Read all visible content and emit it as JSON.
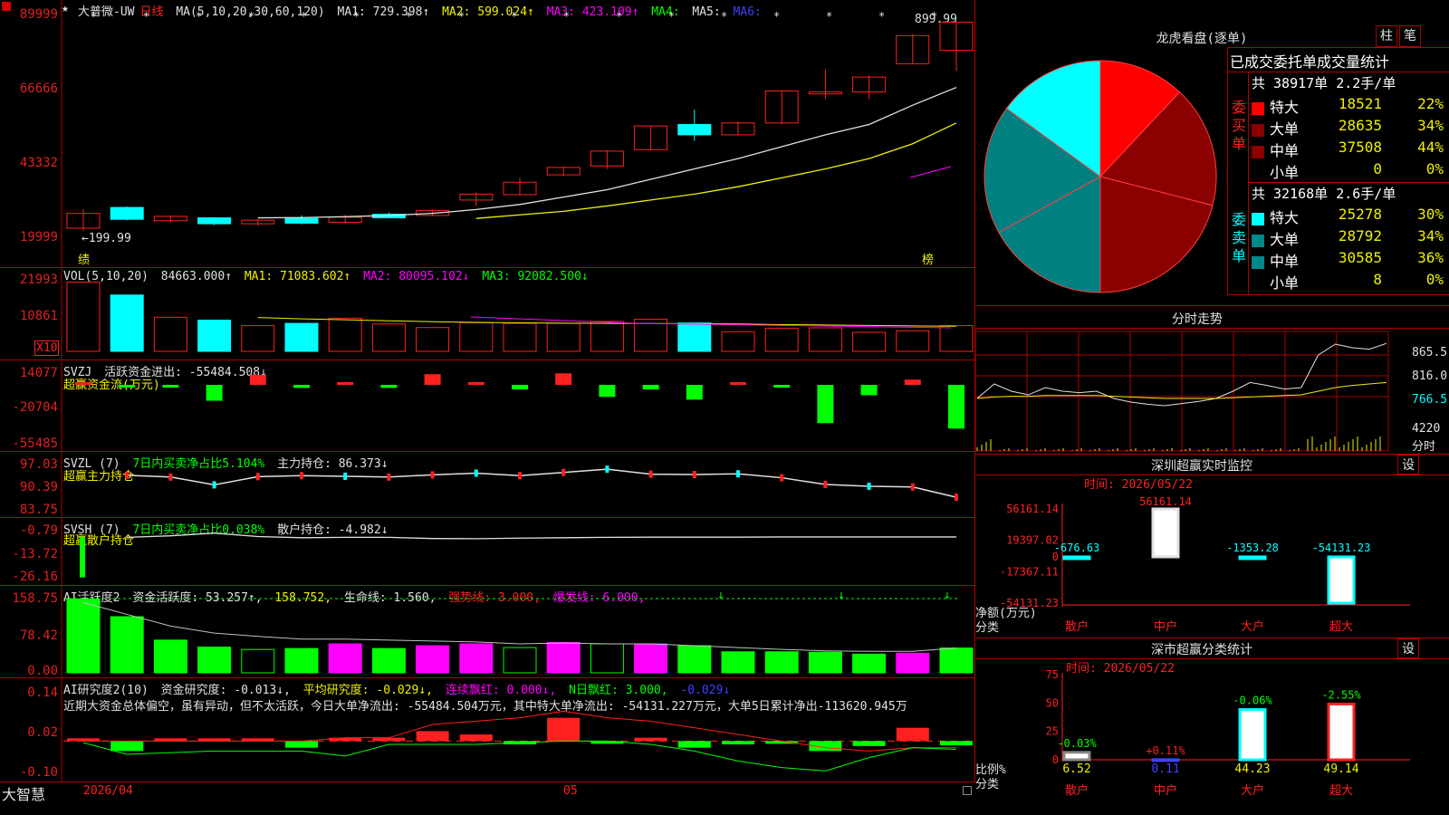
{
  "colors": {
    "up": "#ff2020",
    "down": "#00ffff",
    "grid": "#b00000",
    "green": "#00ff00",
    "magenta": "#ff00ff",
    "yellow": "#f0f000",
    "teal": "#008888",
    "darkred": "#8b0000"
  },
  "main": {
    "title": "大普微-UW",
    "period": "日线",
    "ma_label": "MA(5,10,20,30,60,120)",
    "ma1": "MA1: 729.398↑",
    "ma2": "MA2: 599.024↑",
    "ma3": "MA3: 423.109↑",
    "ma4": "MA4:",
    "ma5": "MA5:",
    "ma6": "MA6:",
    "y_ticks": [
      "89999",
      "66666",
      "43332",
      "19999"
    ],
    "high_label": "899.99",
    "low_label": "←199.99",
    "badge_left": "绩",
    "badge_right": "榜",
    "candles": [
      {
        "o": 205,
        "c": 255,
        "h": 270,
        "l": 195
      },
      {
        "o": 275,
        "c": 235,
        "h": 278,
        "l": 232
      },
      {
        "o": 230,
        "c": 245,
        "h": 248,
        "l": 226
      },
      {
        "o": 240,
        "c": 220,
        "h": 242,
        "l": 215
      },
      {
        "o": 220,
        "c": 232,
        "h": 236,
        "l": 214
      },
      {
        "o": 238,
        "c": 222,
        "h": 248,
        "l": 218
      },
      {
        "o": 225,
        "c": 242,
        "h": 250,
        "l": 222
      },
      {
        "o": 252,
        "c": 240,
        "h": 258,
        "l": 238
      },
      {
        "o": 248,
        "c": 265,
        "h": 268,
        "l": 245
      },
      {
        "o": 300,
        "c": 320,
        "h": 325,
        "l": 280
      },
      {
        "o": 318,
        "c": 360,
        "h": 375,
        "l": 315
      },
      {
        "o": 385,
        "c": 410,
        "h": 412,
        "l": 380
      },
      {
        "o": 415,
        "c": 465,
        "h": 468,
        "l": 405
      },
      {
        "o": 470,
        "c": 550,
        "h": 552,
        "l": 468
      },
      {
        "o": 555,
        "c": 520,
        "h": 605,
        "l": 500
      },
      {
        "o": 520,
        "c": 560,
        "h": 565,
        "l": 518
      },
      {
        "o": 560,
        "c": 668,
        "h": 670,
        "l": 555
      },
      {
        "o": 658,
        "c": 665,
        "h": 740,
        "l": 640
      },
      {
        "o": 665,
        "c": 715,
        "h": 720,
        "l": 640
      },
      {
        "o": 760,
        "c": 855,
        "h": 860,
        "l": 758
      },
      {
        "o": 805,
        "c": 899.99,
        "h": 899.99,
        "l": 735
      }
    ],
    "ma_white": [
      null,
      null,
      null,
      null,
      240,
      241,
      244,
      248,
      255,
      268,
      285,
      310,
      335,
      370,
      405,
      440,
      480,
      520,
      555,
      620,
      680
    ],
    "ma_yellow": [
      null,
      null,
      null,
      null,
      null,
      null,
      null,
      null,
      null,
      238,
      250,
      262,
      280,
      300,
      320,
      345,
      375,
      405,
      440,
      490,
      560
    ]
  },
  "vol": {
    "label": "VOL(5,10,20)",
    "value": "84663.000↑",
    "ma1": "MA1: 71083.602↑",
    "ma2": "MA2: 80095.102↓",
    "ma3": "MA3: 92082.500↓",
    "y_ticks": [
      "21993",
      "10861"
    ],
    "unit": "X10",
    "bars": [
      21500,
      17500,
      10600,
      9700,
      8000,
      8700,
      10300,
      8500,
      7400,
      8900,
      8700,
      8700,
      9300,
      10000,
      8800,
      6100,
      7200,
      7300,
      5900,
      6400,
      8000
    ],
    "ma_yellow": [
      null,
      null,
      null,
      null,
      10500,
      10100,
      9800,
      9500,
      9200,
      9000,
      8850,
      8750,
      8700,
      8650,
      8600,
      8500,
      8300,
      8200,
      8050,
      7900,
      7800
    ]
  },
  "svzj": {
    "label": "SVZJ",
    "title": "活跃资金进出: -55484.508↓",
    "sub": "超赢资金流(万元)",
    "y_ticks": [
      "14077",
      "-20704",
      "-55485"
    ],
    "values": [
      800,
      -1200,
      -400,
      -14500,
      9200,
      -2800,
      1800,
      -2800,
      9800,
      1800,
      -4200,
      10500,
      -11000,
      -4200,
      -13500,
      2000,
      -1500,
      -35000,
      -9500,
      4800,
      -40000
    ]
  },
  "svzl": {
    "label": "SVZL (7)",
    "title": "7日内买卖净占比5.104%",
    "value": "主力持仓: 86.373↓",
    "sub": "超赢主力持仓",
    "y_ticks": [
      "97.03",
      "90.39",
      "83.75"
    ],
    "line": [
      null,
      93.5,
      93.0,
      90.8,
      93.1,
      93.4,
      93.2,
      93.0,
      93.6,
      94.1,
      93.4,
      94.3,
      95.2,
      93.8,
      93.7,
      93.9,
      92.8,
      90.9,
      90.4,
      90.2,
      87.3
    ]
  },
  "svsh": {
    "label": "SVSH (7)",
    "title": "7日内买卖净占比0.038%",
    "value": "散户持仓: -4.982↓",
    "sub": "超赢散户持仓",
    "y_ticks": [
      "-0.79",
      "-13.72",
      "-26.16"
    ],
    "line": [
      null,
      -5.2,
      -4.4,
      -3.0,
      -4.8,
      -5.4,
      -5.2,
      -5.2,
      -5.8,
      -5.9,
      -5.6,
      -5.4,
      -5.2,
      -5.1,
      -5.1,
      -5.1,
      -5.0,
      -5.0,
      -5.0,
      -5.0,
      -5.0
    ]
  },
  "ai_active": {
    "label": "AI活跃度2",
    "title": "资金活跃度: 53.257↑,",
    "v2": "158.752,",
    "v3": "生命线: 1.560,",
    "v4": "强势线: 3.000,",
    "v5": "爆发线: 6.000,",
    "y_ticks": [
      "158.75",
      "78.42",
      "0.00"
    ],
    "bars": [
      {
        "v": 158,
        "c": "g"
      },
      {
        "v": 120,
        "c": "g"
      },
      {
        "v": 70,
        "c": "g"
      },
      {
        "v": 55,
        "c": "g"
      },
      {
        "v": 50,
        "c": "go"
      },
      {
        "v": 52,
        "c": "g"
      },
      {
        "v": 62,
        "c": "m"
      },
      {
        "v": 52,
        "c": "g"
      },
      {
        "v": 58,
        "c": "m"
      },
      {
        "v": 62,
        "c": "m"
      },
      {
        "v": 54,
        "c": "go"
      },
      {
        "v": 65,
        "c": "m"
      },
      {
        "v": 62,
        "c": "go"
      },
      {
        "v": 62,
        "c": "m"
      },
      {
        "v": 58,
        "c": "g"
      },
      {
        "v": 45,
        "c": "g"
      },
      {
        "v": 45,
        "c": "g"
      },
      {
        "v": 44,
        "c": "g"
      },
      {
        "v": 40,
        "c": "g"
      },
      {
        "v": 42,
        "c": "m"
      },
      {
        "v": 53,
        "c": "g"
      }
    ],
    "line": [
      150,
      125,
      100,
      85,
      78,
      72,
      72,
      70,
      68,
      66,
      62,
      64,
      62,
      62,
      58,
      54,
      50,
      47,
      46,
      46,
      53
    ]
  },
  "ai_research": {
    "label": "AI研究度2(10)",
    "title": "资金研究度: -0.013↓,",
    "v2": "平均研究度: -0.029↓,",
    "v3": "连续飘红: 0.000↓,",
    "v4": "N日飘红: 3.000,",
    "v5": "-0.029↓",
    "comment": "近期大资金总体偏空，虽有异动，但不太活跃，今日大单净流出: -55484.504万元，其中特大单净流出: -54131.227万元，大单5日累计净出-113620.945万",
    "y_ticks": [
      "0.14",
      "0.02",
      "-0.10"
    ],
    "bars": [
      0.0,
      -0.03,
      0.0,
      0.0,
      0.0,
      -0.02,
      0.01,
      0.01,
      0.03,
      0.02,
      -0.01,
      0.07,
      -0.005,
      0.01,
      -0.02,
      -0.01,
      -0.005,
      -0.03,
      -0.015,
      0.04,
      -0.013
    ],
    "red": [
      0.0,
      0.0,
      0.0,
      0.0,
      0.0,
      0.0,
      0.01,
      0.01,
      0.05,
      0.06,
      0.07,
      0.09,
      0.07,
      0.06,
      0.04,
      0.02,
      0.0,
      -0.02,
      -0.03,
      -0.02,
      -0.02
    ],
    "green": [
      -0.005,
      -0.04,
      -0.035,
      -0.03,
      -0.03,
      -0.03,
      -0.045,
      -0.01,
      -0.01,
      -0.01,
      -0.005,
      0.0,
      0.0,
      -0.01,
      -0.03,
      -0.06,
      -0.08,
      -0.09,
      -0.05,
      -0.02,
      -0.025
    ]
  },
  "bottom": {
    "brand": "大智慧",
    "date1": "2026/04",
    "date2": "05"
  },
  "dragon": {
    "title": "龙虎看盘(逐单)",
    "btn1": "柱",
    "btn2": "笔",
    "header": "已成交委托单成交量统计",
    "buy_label": "委买单",
    "buy_total": "共 38917单 2.2手/单",
    "buy": [
      {
        "name": "特大",
        "n": "18521",
        "p": "22%",
        "color": "#ff0000"
      },
      {
        "name": "大单",
        "n": "28635",
        "p": "34%",
        "color": "#8b0000"
      },
      {
        "name": "中单",
        "n": "37508",
        "p": "44%",
        "color": "#8b0000"
      },
      {
        "name": "小单",
        "n": "0",
        "p": "0%",
        "color": "#000"
      }
    ],
    "sell_label": "委卖单",
    "sell_total": "共 32168单 2.6手/单",
    "sell": [
      {
        "name": "特大",
        "n": "25278",
        "p": "30%",
        "color": "#00ffff"
      },
      {
        "name": "大单",
        "n": "28792",
        "p": "34%",
        "color": "#008888"
      },
      {
        "name": "中单",
        "n": "30585",
        "p": "36%",
        "color": "#008888"
      },
      {
        "name": "小单",
        "n": "8",
        "p": "0%",
        "color": "#000"
      }
    ],
    "pie": [
      {
        "v": 12,
        "c": "#ff0000"
      },
      {
        "v": 17,
        "c": "#8b0000"
      },
      {
        "v": 21,
        "c": "#8b0000"
      },
      {
        "v": 17,
        "c": "#008080"
      },
      {
        "v": 18,
        "c": "#008080"
      },
      {
        "v": 15,
        "c": "#00ffff"
      }
    ]
  },
  "intraday": {
    "title": "分时走势",
    "y_ticks": [
      "865.5",
      "816.0",
      "766.5",
      "4220"
    ],
    "unit": "分时",
    "line": [
      790,
      810,
      800,
      795,
      805,
      800,
      798,
      800,
      790,
      785,
      782,
      780,
      783,
      786,
      790,
      800,
      812,
      808,
      803,
      805,
      850,
      865,
      860,
      858,
      866
    ],
    "avg": [
      790,
      792,
      793,
      793,
      794,
      794,
      794,
      794,
      793,
      792,
      791,
      790,
      790,
      790,
      790,
      791,
      792,
      793,
      794,
      795,
      800,
      805,
      808,
      810,
      812
    ]
  },
  "sz_monitor": {
    "title": "深圳超赢实时监控",
    "btn": "设",
    "time": "时间: 2026/05/22",
    "y_ticks": [
      "56161.14",
      "19397.02",
      "0",
      "-17367.11",
      "-54131.23"
    ],
    "ylabel": "净额(万元)",
    "xlabel": "分类",
    "cats": [
      "散户",
      "中户",
      "大户",
      "超大"
    ],
    "values": [
      -676.63,
      56161.14,
      -1353.28,
      -54131.23
    ],
    "labels": [
      "-676.63",
      "56161.14",
      "-1353.28",
      "-54131.23"
    ]
  },
  "sz_class": {
    "title": "深市超赢分类统计",
    "btn": "设",
    "time": "时间: 2026/05/22",
    "y_ticks": [
      "75",
      "50",
      "25",
      "0"
    ],
    "ylabel": "比例%",
    "xlabel": "分类",
    "cats": [
      "散户",
      "中户",
      "大户",
      "超大"
    ],
    "values": [
      6.52,
      0.11,
      44.23,
      49.14
    ],
    "vlabels": [
      "6.52",
      "0.11",
      "44.23",
      "49.14"
    ],
    "deltas": [
      "-0.03%",
      "+0.11%",
      "-0.06%",
      "-2.55%"
    ]
  }
}
